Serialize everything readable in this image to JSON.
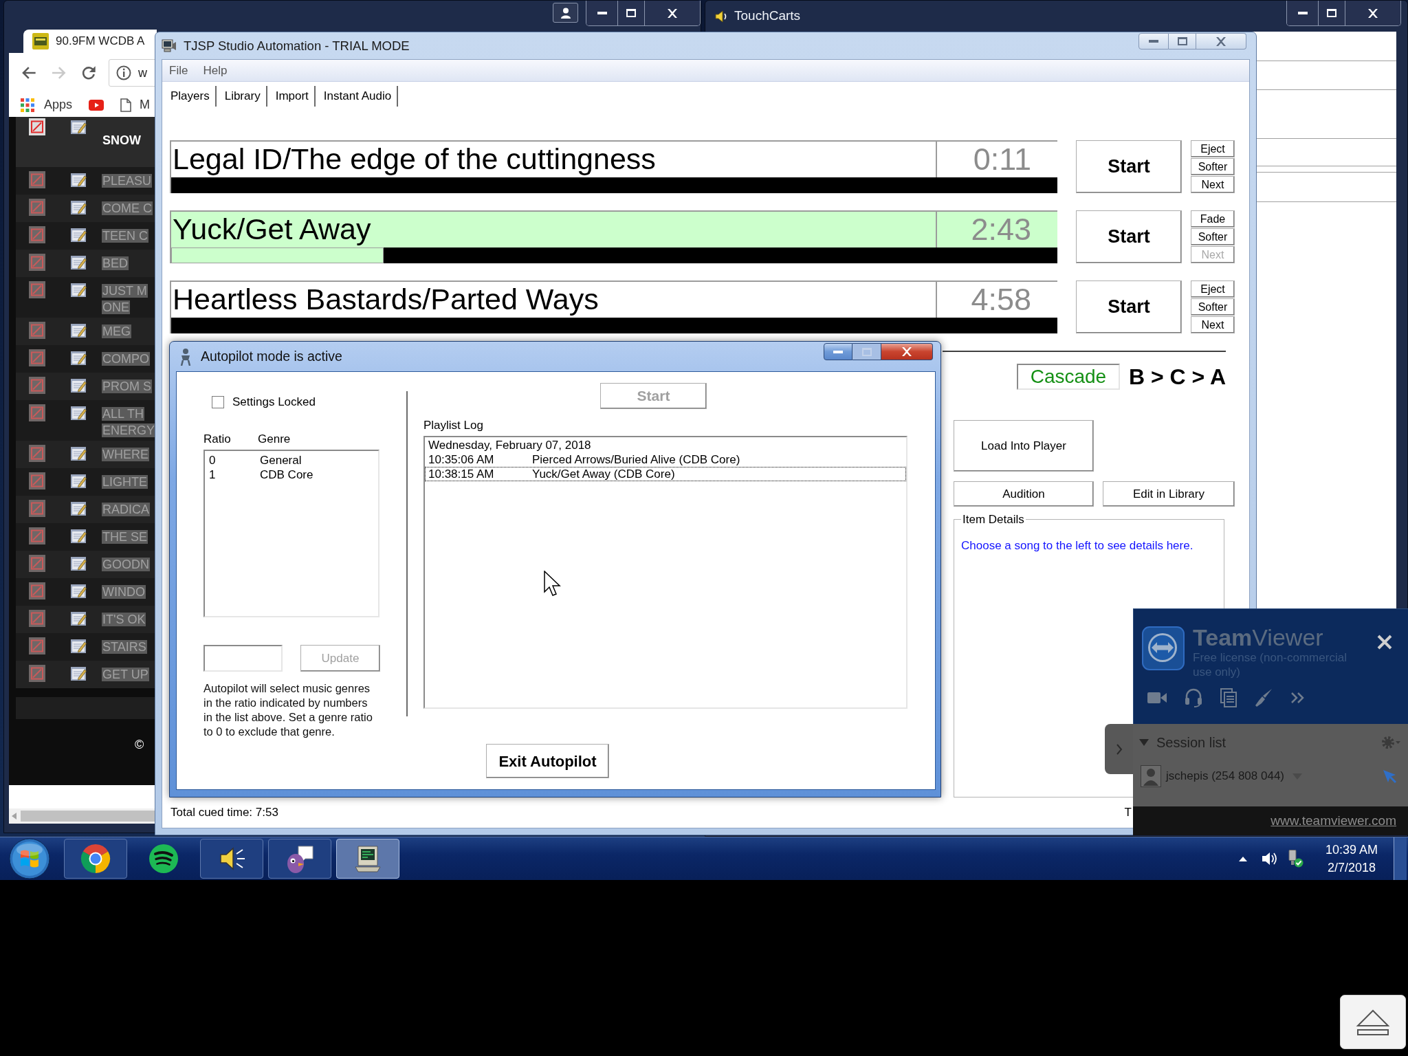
{
  "browser_window": {
    "tab_title": "90.9FM WCDB A",
    "navigation": {
      "back_disabled": false,
      "forward_disabled": true
    },
    "address": "w",
    "bookmarks": [
      {
        "kind": "apps",
        "label": "Apps"
      },
      {
        "kind": "video"
      },
      {
        "kind": "page",
        "label": "M"
      }
    ],
    "rows": [
      {
        "lines": [
          "SNOW"
        ],
        "current": true
      },
      {
        "lines": [
          "PLEASU"
        ],
        "current": false
      },
      {
        "lines": [
          "COME C"
        ],
        "current": false
      },
      {
        "lines": [
          "TEEN C"
        ],
        "current": false
      },
      {
        "lines": [
          "BED"
        ],
        "current": false
      },
      {
        "lines": [
          "JUST M",
          "ONE"
        ],
        "current": false
      },
      {
        "lines": [
          "MEG"
        ],
        "current": false
      },
      {
        "lines": [
          "COMPO"
        ],
        "current": false
      },
      {
        "lines": [
          "PROM S"
        ],
        "current": false
      },
      {
        "lines": [
          "ALL TH",
          "ENERGY"
        ],
        "current": false
      },
      {
        "lines": [
          "WHERE"
        ],
        "current": false
      },
      {
        "lines": [
          "LIGHTE"
        ],
        "current": false
      },
      {
        "lines": [
          "RADICA"
        ],
        "current": false
      },
      {
        "lines": [
          "THE SE"
        ],
        "current": false
      },
      {
        "lines": [
          "GOODN"
        ],
        "current": false
      },
      {
        "lines": [
          "WINDO"
        ],
        "current": false
      },
      {
        "lines": [
          "IT'S OK"
        ],
        "current": false
      },
      {
        "lines": [
          "STAIRS"
        ],
        "current": false
      },
      {
        "lines": [
          "GET UP"
        ],
        "current": false
      }
    ],
    "footer": "©"
  },
  "touchcarts_window": {
    "title": "TouchCarts"
  },
  "studio_window": {
    "title": "TJSP Studio Automation - TRIAL MODE",
    "menu": [
      "File",
      "Help"
    ],
    "tabs": [
      "Players",
      "Library",
      "Import",
      "Instant Audio"
    ],
    "players": [
      {
        "title": "Legal ID/The edge of the cuttingness",
        "time": "0:11",
        "playing": false,
        "start": "Start",
        "buttons": [
          {
            "label": "Eject",
            "disabled": false
          },
          {
            "label": "Softer",
            "disabled": false
          },
          {
            "label": "Next",
            "disabled": false
          }
        ]
      },
      {
        "title": "Yuck/Get Away",
        "time": "2:43",
        "playing": true,
        "level": 0.24,
        "start": "Start",
        "buttons": [
          {
            "label": "Fade",
            "disabled": false
          },
          {
            "label": "Softer",
            "disabled": false
          },
          {
            "label": "Next",
            "disabled": true
          }
        ]
      },
      {
        "title": "Heartless Bastards/Parted Ways",
        "time": "4:58",
        "playing": false,
        "start": "Start",
        "buttons": [
          {
            "label": "Eject",
            "disabled": false
          },
          {
            "label": "Softer",
            "disabled": false
          },
          {
            "label": "Next",
            "disabled": false
          }
        ]
      }
    ],
    "cascade": {
      "label": "Cascade",
      "on": true,
      "order": "B > C > A"
    },
    "load_button": "Load Into Player",
    "audition_button": "Audition",
    "edit_button": "Edit in Library",
    "item_details": {
      "legend": "Item Details",
      "message": "Choose a song to the left to see details here."
    },
    "status_bar": [
      "Total cued time: 7:53",
      "T"
    ]
  },
  "autopilot_dialog": {
    "title": "Autopilot mode is active",
    "controls": [
      {
        "kind": "minimize",
        "disabled": false
      },
      {
        "kind": "maximize",
        "disabled": true
      },
      {
        "kind": "close",
        "disabled": false
      }
    ],
    "settings_locked": {
      "label": "Settings Locked",
      "checked": false
    },
    "ratio_columns": [
      "Ratio",
      "Genre"
    ],
    "ratios": [
      {
        "ratio": "0",
        "genre": "General"
      },
      {
        "ratio": "1",
        "genre": "CDB Core"
      }
    ],
    "update_button": {
      "label": "Update",
      "disabled": true
    },
    "help": "Autopilot will select music genres in the ratio indicated by numbers in the list above. Set a genre ratio to 0 to exclude that genre.",
    "start_button": {
      "label": "Start",
      "disabled": true
    },
    "log_label": "Playlist Log",
    "log": [
      {
        "kind": "date",
        "text": "Wednesday, February 07, 2018",
        "selected": false
      },
      {
        "kind": "entry",
        "time": "10:35:06 AM",
        "title": "Pierced Arrows/Buried Alive (CDB Core)",
        "selected": false
      },
      {
        "kind": "entry",
        "time": "10:38:15 AM",
        "title": "Yuck/Get Away (CDB Core)",
        "selected": true
      }
    ],
    "exit_button": "Exit Autopilot"
  },
  "teamviewer": {
    "brand": "**Team**Viewer",
    "license": "Free license (non-commercial use only)",
    "session_list": {
      "label": "Session list",
      "expanded": true
    },
    "sessions": [
      {
        "name": "jschepis (254 808 044)"
      }
    ],
    "link": "www.teamviewer.com"
  },
  "taskbar": {
    "apps": [
      {
        "kind": "browser",
        "running": true,
        "active": false
      },
      {
        "kind": "music",
        "running": false,
        "active": false
      },
      {
        "kind": "speaker",
        "running": true,
        "active": false
      },
      {
        "kind": "chat",
        "running": true,
        "active": false
      },
      {
        "kind": "computer",
        "running": true,
        "active": true
      }
    ],
    "clock": {
      "time": "10:39 AM",
      "date": "2/7/2018"
    }
  }
}
